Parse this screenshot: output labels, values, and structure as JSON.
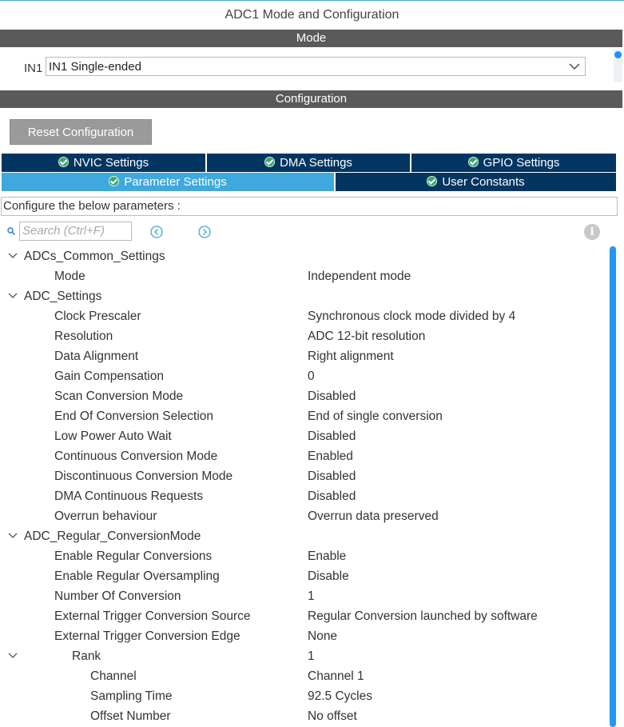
{
  "window_title": "ADC1 Mode and Configuration",
  "mode_section": {
    "header": "Mode",
    "input_label": "IN1",
    "input_value": "IN1 Single-ended"
  },
  "configuration_section": {
    "header": "Configuration",
    "reset_label": "Reset Configuration"
  },
  "tabs": [
    {
      "label": "NVIC Settings",
      "active": false
    },
    {
      "label": "DMA Settings",
      "active": false
    },
    {
      "label": "GPIO Settings",
      "active": false
    },
    {
      "label": "Parameter Settings",
      "active": true
    },
    {
      "label": "User Constants",
      "active": false
    }
  ],
  "params_caption": "Configure the below parameters :",
  "search": {
    "placeholder": "Search (Ctrl+F)"
  },
  "colors": {
    "accent": "#3fa8de",
    "tab_dark": "#033561",
    "header_bar": "#5a5a5a",
    "check": "#3aa76d"
  },
  "tree": {
    "group_common": "ADCs_Common_Settings",
    "common": [
      {
        "key": "Mode",
        "value": "Independent mode"
      }
    ],
    "group_adc": "ADC_Settings",
    "adc": [
      {
        "key": "Clock Prescaler",
        "value": "Synchronous clock mode divided by 4"
      },
      {
        "key": "Resolution",
        "value": "ADC 12-bit resolution"
      },
      {
        "key": "Data Alignment",
        "value": "Right alignment"
      },
      {
        "key": "Gain Compensation",
        "value": "0"
      },
      {
        "key": "Scan Conversion Mode",
        "value": "Disabled"
      },
      {
        "key": "End Of Conversion Selection",
        "value": "End of single conversion"
      },
      {
        "key": "Low Power Auto Wait",
        "value": "Disabled"
      },
      {
        "key": "Continuous Conversion Mode",
        "value": "Enabled"
      },
      {
        "key": "Discontinuous Conversion Mode",
        "value": "Disabled"
      },
      {
        "key": "DMA Continuous Requests",
        "value": "Disabled"
      },
      {
        "key": "Overrun behaviour",
        "value": "Overrun data preserved"
      }
    ],
    "group_regular": "ADC_Regular_ConversionMode",
    "regular": [
      {
        "key": "Enable Regular Conversions",
        "value": "Enable"
      },
      {
        "key": "Enable Regular Oversampling",
        "value": "Disable"
      },
      {
        "key": "Number Of Conversion",
        "value": "1"
      },
      {
        "key": "External Trigger Conversion Source",
        "value": "Regular Conversion launched by software"
      },
      {
        "key": "External Trigger Conversion Edge",
        "value": "None"
      }
    ],
    "rank": {
      "key": "Rank",
      "value": "1"
    },
    "rank_items": [
      {
        "key": "Channel",
        "value": "Channel 1"
      },
      {
        "key": "Sampling Time",
        "value": "92.5 Cycles"
      },
      {
        "key": "Offset Number",
        "value": "No offset"
      }
    ]
  }
}
